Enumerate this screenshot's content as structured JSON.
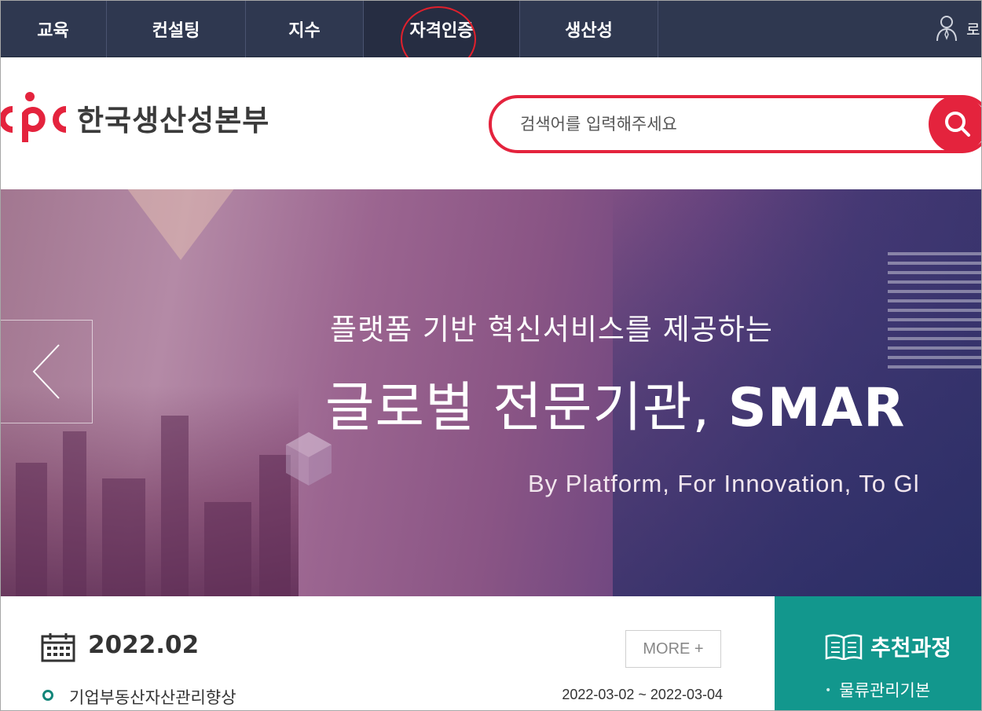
{
  "nav": {
    "items": [
      {
        "label": "교육"
      },
      {
        "label": "컨설팅"
      },
      {
        "label": "지수"
      },
      {
        "label": "자격인증"
      },
      {
        "label": "생산성"
      }
    ],
    "login_label": "로"
  },
  "header": {
    "logo_text": "한국생산성본부",
    "search_placeholder": "검색어를 입력해주세요"
  },
  "hero": {
    "subtitle": "플랫폼 기반 혁신서비스를 제공하는",
    "title_korean": "글로벌 전문기관,",
    "title_english": "SMAR",
    "tagline": "By Platform,  For Innovation, To Gl"
  },
  "schedule": {
    "month": "2022.02",
    "more_label": "MORE +",
    "courses": [
      {
        "title": "기업부동산자산관리향상",
        "date": "2022-03-02 ~ 2022-03-04"
      }
    ]
  },
  "recommended": {
    "title": "추천과정",
    "items": [
      {
        "label": "물류관리기본"
      }
    ]
  },
  "colors": {
    "nav_bg": "#2f3850",
    "brand_red": "#e4233d",
    "teal": "#12978d"
  }
}
